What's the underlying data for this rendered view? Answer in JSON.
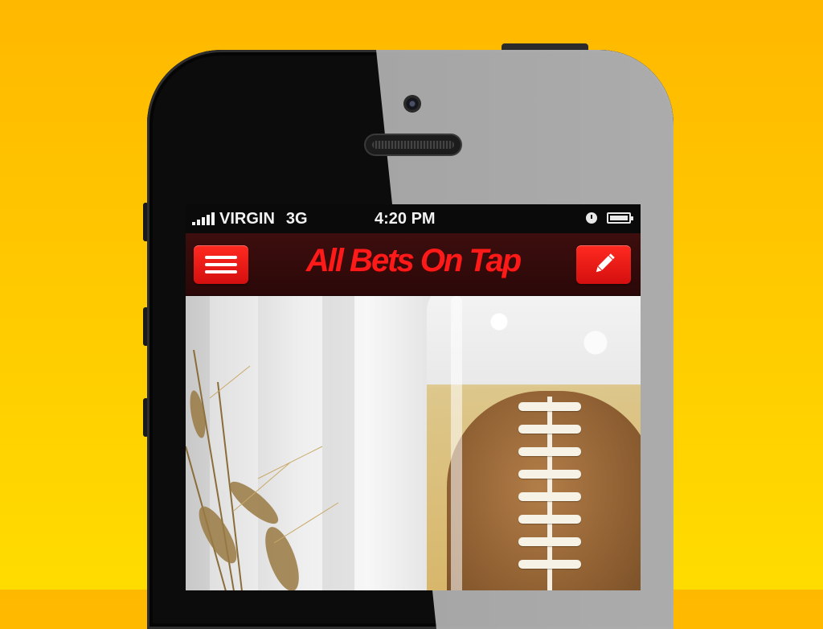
{
  "statusbar": {
    "carrier": "VIRGIN",
    "network": "3G",
    "time": "4:20 PM",
    "icons": [
      "signal-bars-icon",
      "clock-icon",
      "battery-icon"
    ]
  },
  "navbar": {
    "title": "All Bets On Tap",
    "left_button_icon": "hamburger-menu-icon",
    "right_button_icon": "pencil-icon",
    "accent_color": "#ff1a1a",
    "bar_color": "#2b0808"
  },
  "hero": {
    "image": "beer-glass-football-wheat-photo"
  },
  "background_color": "#ffc800"
}
